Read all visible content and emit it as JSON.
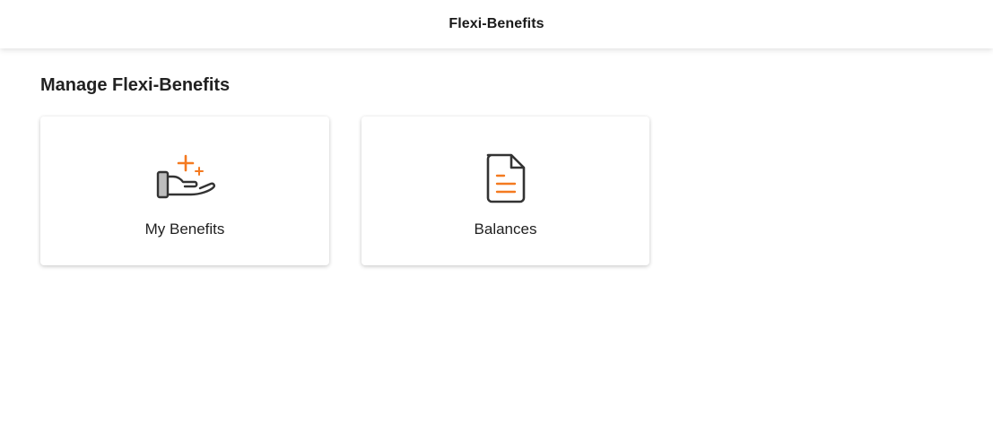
{
  "header": {
    "title": "Flexi-Benefits"
  },
  "main": {
    "section_title": "Manage Flexi-Benefits",
    "cards": [
      {
        "label": "My Benefits",
        "icon": "hand-benefits-icon"
      },
      {
        "label": "Balances",
        "icon": "document-icon"
      }
    ]
  },
  "colors": {
    "accent": "#F47A20",
    "icon_stroke": "#333333"
  }
}
